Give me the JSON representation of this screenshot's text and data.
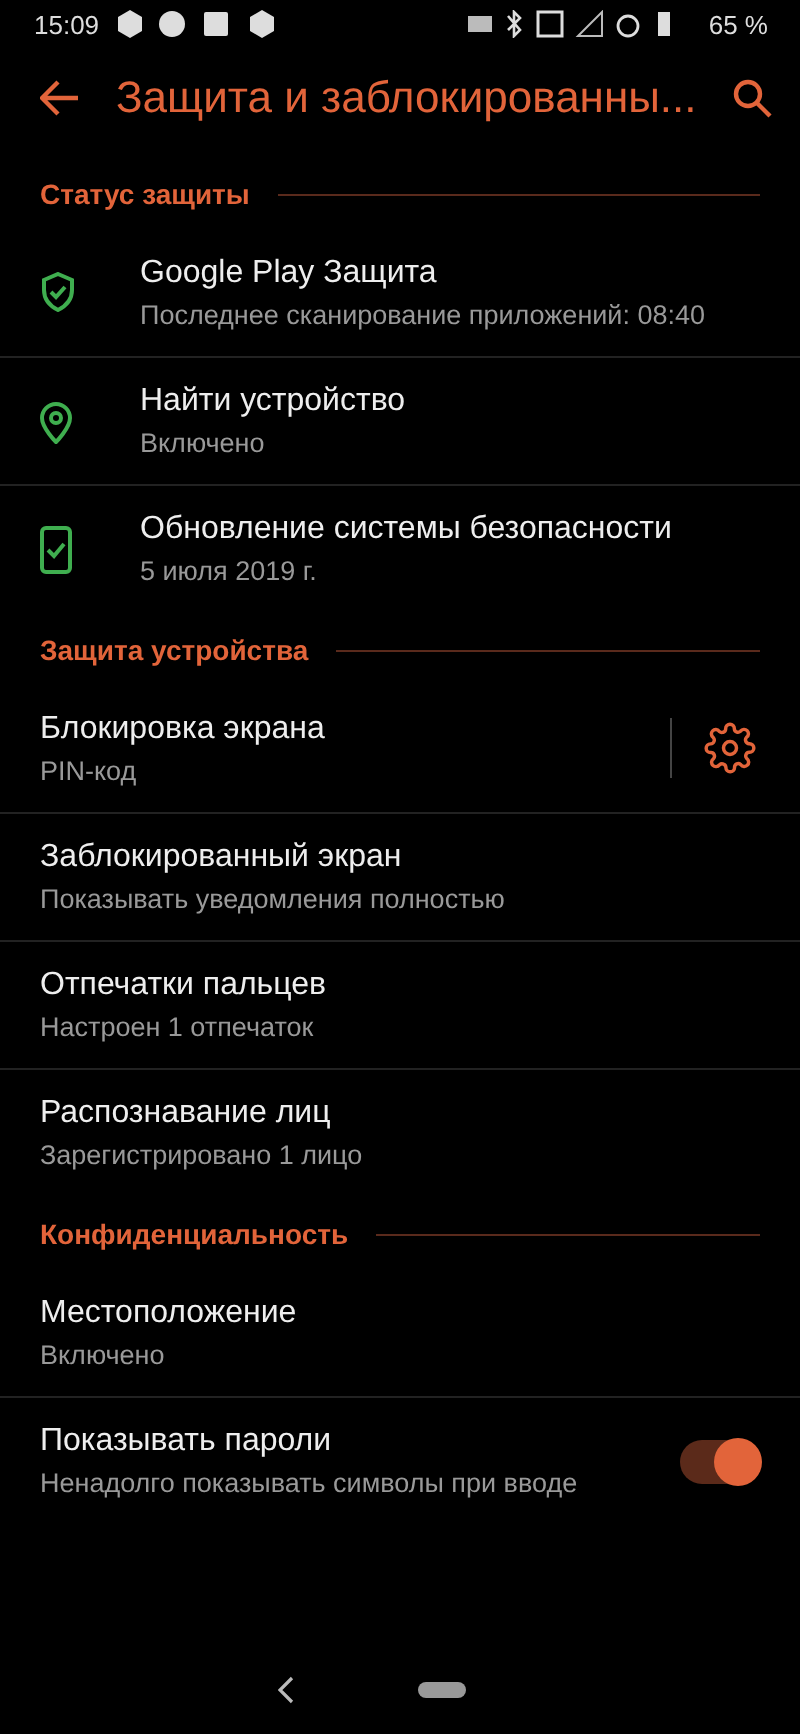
{
  "status_bar": {
    "time": "15:09",
    "battery": "65 %"
  },
  "header": {
    "title": "Защита и заблокированны..."
  },
  "sections": [
    {
      "title": "Статус защиты",
      "items": [
        {
          "kind": "icon",
          "title": "Google Play Защита",
          "subtitle": "Последнее сканирование приложений: 08:40"
        },
        {
          "kind": "icon",
          "title": "Найти устройство",
          "subtitle": "Включено"
        },
        {
          "kind": "icon",
          "title": "Обновление системы безопасности",
          "subtitle": "5 июля 2019 г."
        }
      ]
    },
    {
      "title": "Защита устройства",
      "items": [
        {
          "kind": "settings",
          "title": "Блокировка экрана",
          "subtitle": "PIN-код"
        },
        {
          "kind": "plain",
          "title": "Заблокированный экран",
          "subtitle": "Показывать уведомления полностью"
        },
        {
          "kind": "plain",
          "title": "Отпечатки пальцев",
          "subtitle": "Настроен 1 отпечаток"
        },
        {
          "kind": "plain",
          "title": "Распознавание лиц",
          "subtitle": "Зарегистрировано 1 лицо"
        }
      ]
    },
    {
      "title": "Конфиденциальность",
      "items": [
        {
          "kind": "plain",
          "title": "Местоположение",
          "subtitle": "Включено"
        },
        {
          "kind": "switch",
          "title": "Показывать пароли",
          "subtitle": "Ненадолго показывать символы при вводе",
          "on": true
        }
      ]
    }
  ]
}
